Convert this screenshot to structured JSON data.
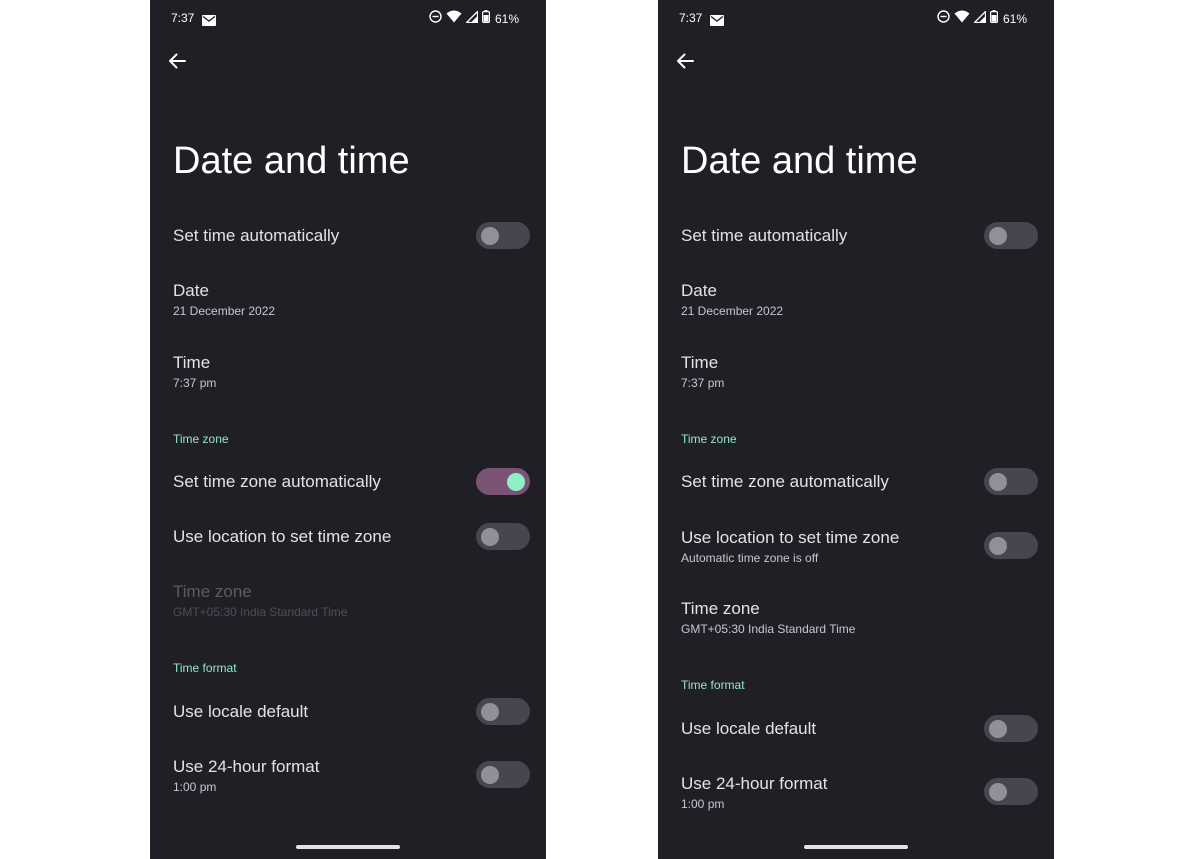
{
  "status_bar": {
    "time": "7:37",
    "battery": "61%"
  },
  "left_screen": {
    "title": "Date and time",
    "set_time_auto": {
      "label": "Set time automatically",
      "on": false
    },
    "date": {
      "label": "Date",
      "value": "21 December 2022"
    },
    "time": {
      "label": "Time",
      "value": "7:37 pm"
    },
    "time_zone_section": "Time zone",
    "set_time_zone_auto": {
      "label": "Set time zone automatically",
      "on": true
    },
    "use_location": {
      "label": "Use location to set time zone",
      "on": false
    },
    "time_zone": {
      "label": "Time zone",
      "value": "GMT+05:30 India Standard Time",
      "disabled": true
    },
    "time_format_section": "Time format",
    "use_locale_default": {
      "label": "Use locale default",
      "on": false
    },
    "use_24_hour": {
      "label": "Use 24-hour format",
      "value": "1:00 pm",
      "on": false
    }
  },
  "right_screen": {
    "title": "Date and time",
    "set_time_auto": {
      "label": "Set time automatically",
      "on": false
    },
    "date": {
      "label": "Date",
      "value": "21 December 2022"
    },
    "time": {
      "label": "Time",
      "value": "7:37 pm"
    },
    "time_zone_section": "Time zone",
    "set_time_zone_auto": {
      "label": "Set time zone automatically",
      "on": false
    },
    "use_location": {
      "label": "Use location to set time zone",
      "value": "Automatic time zone is off",
      "on": false
    },
    "time_zone": {
      "label": "Time zone",
      "value": "GMT+05:30 India Standard Time",
      "disabled": false
    },
    "time_format_section": "Time format",
    "use_locale_default": {
      "label": "Use locale default",
      "on": false
    },
    "use_24_hour": {
      "label": "Use 24-hour format",
      "value": "1:00 pm",
      "on": false
    }
  },
  "icons": {
    "back": "arrow-left-icon",
    "mail": "mail-icon",
    "dnd": "do-not-disturb-icon",
    "wifi": "wifi-icon",
    "signal": "cell-signal-icon",
    "battery": "battery-icon"
  },
  "colors": {
    "background": "#211f26",
    "accent_section": "#8fe8c4",
    "toggle_on_track": "#7b5375",
    "toggle_on_thumb": "#8ff0c6",
    "toggle_off_track": "#48454e",
    "toggle_off_thumb": "#938f99"
  }
}
